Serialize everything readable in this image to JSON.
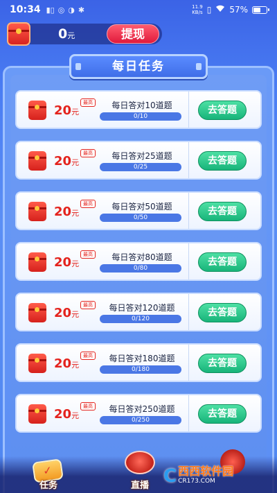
{
  "status_bar": {
    "time": "10:34",
    "network": "11.9\nKB/s",
    "battery_percent": "57%",
    "battery_level": 0.57
  },
  "balance": {
    "amount": "0",
    "unit": "元",
    "withdraw_label": "提现"
  },
  "panel": {
    "title": "每日任务"
  },
  "tasks": [
    {
      "reward": "20",
      "unit": "元",
      "tag": "最高",
      "name": "每日答对10道题",
      "progress": "0/10",
      "fraction": 0,
      "action": "去答题"
    },
    {
      "reward": "20",
      "unit": "元",
      "tag": "最高",
      "name": "每日答对25道题",
      "progress": "0/25",
      "fraction": 0,
      "action": "去答题"
    },
    {
      "reward": "20",
      "unit": "元",
      "tag": "最高",
      "name": "每日答对50道题",
      "progress": "0/50",
      "fraction": 0,
      "action": "去答题"
    },
    {
      "reward": "20",
      "unit": "元",
      "tag": "最高",
      "name": "每日答对80道题",
      "progress": "0/80",
      "fraction": 0,
      "action": "去答题"
    },
    {
      "reward": "20",
      "unit": "元",
      "tag": "最高",
      "name": "每日答对120道题",
      "progress": "0/120",
      "fraction": 0,
      "action": "去答题"
    },
    {
      "reward": "20",
      "unit": "元",
      "tag": "最高",
      "name": "每日答对180道题",
      "progress": "0/180",
      "fraction": 0,
      "action": "去答题"
    },
    {
      "reward": "20",
      "unit": "元",
      "tag": "最高",
      "name": "每日答对250道题",
      "progress": "0/250",
      "fraction": 0,
      "action": "去答题"
    }
  ],
  "dock": {
    "task_label": "任务",
    "live_label": "直播"
  },
  "watermark": {
    "logo": "C",
    "main": "西西软件园",
    "sub": "CR173.COM"
  },
  "colors": {
    "accent_red": "#e4231d",
    "button_green": "#18b47a",
    "background_blue": "#4a7df3"
  }
}
